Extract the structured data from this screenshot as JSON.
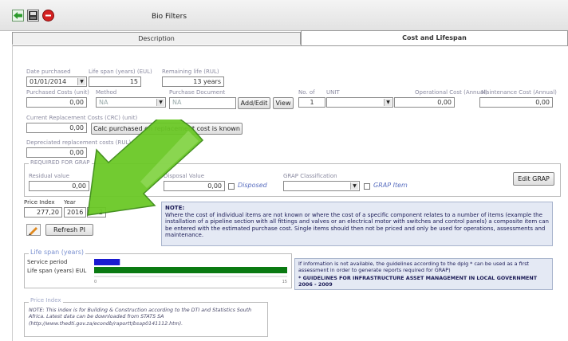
{
  "window": {
    "title": "Bio Filters"
  },
  "toolbar": {
    "back_icon": "green-arrow-icon",
    "save_icon": "disk-icon",
    "delete_icon": "red-minus-icon"
  },
  "tabs": [
    {
      "label": "Description"
    },
    {
      "label": "Cost and Lifespan"
    }
  ],
  "form": {
    "date_purchased": {
      "label": "Date purchased",
      "value": "01/01/2014"
    },
    "life_span": {
      "label": "Life span (years) (EUL)",
      "value": "15"
    },
    "remaining_life": {
      "label": "Remaining life (RUL)",
      "value": "13 years"
    },
    "purchased_costs": {
      "label": "Purchased Costs (unit)",
      "value": "0,00"
    },
    "method": {
      "label": "Method",
      "value": "NA"
    },
    "purchase_document": {
      "label": "Purchase Document",
      "value": "NA"
    },
    "add_edit_label": "Add/Edit",
    "view_label": "View",
    "no_of": {
      "label": "No. of",
      "value": "1"
    },
    "unit": {
      "label": "UNIT",
      "value": ""
    },
    "operational_cost": {
      "label": "Operational Cost (Annual)",
      "value": "0,00"
    },
    "maintenance_cost": {
      "label": "Maintenance Cost (Annual)",
      "value": "0,00"
    },
    "crc": {
      "label": "Current Replacement Costs (CRC) (unit)",
      "value": "0,00"
    },
    "calc_button_label": "Calc purchased on replacement cost is known",
    "depreciated": {
      "label": "Depreciated replacement costs (RUL)",
      "value": "0,00"
    },
    "grap_group_title": "REQUIRED FOR GRAP",
    "residual": {
      "label": "Residual value",
      "value": "0,00"
    },
    "disposal": {
      "label": "Disposal Value",
      "value": "0,00"
    },
    "disposed_label": "Disposed",
    "grap_classification": {
      "label": "GRAP Classification",
      "value": ""
    },
    "grap_item_label": "GRAP Item",
    "edit_grap_label": "Edit GRAP",
    "price_index": {
      "label": "Price Index",
      "value": "277,20"
    },
    "year": {
      "label": "Year",
      "value": "2016",
      "extra": "2"
    },
    "refresh_label": "Refresh PI"
  },
  "note": {
    "title": "NOTE:",
    "body": "Where the cost of individual items are not known or where the cost of a specific component relates to a number of items (example the installation of a pipeline section with all fittings and valves or an electrical motor with switches and control panels) a composite item can be entered with the estimated purchase cost. Single items should then not be priced and only be used for operations, assessments and maintenance."
  },
  "life_span_panel": {
    "title": "Life span (years)",
    "service_label": "Service period",
    "eul_label": "Life span (years) EUL",
    "axis_min": "0",
    "axis_max": "15"
  },
  "chart_data": {
    "type": "bar",
    "categories": [
      "Service period",
      "Life span (years) EUL"
    ],
    "values": [
      2,
      15
    ],
    "xlim": [
      0,
      15
    ],
    "colors": [
      "#1a1ad0",
      "#0a7a12"
    ]
  },
  "guidelines": {
    "text": "If information is not available, the guidelines according to the dplg * can be used as a first assessment in order to generate reports required for GRAP)",
    "title": "* GUIDELINES FOR INFRASTRUCTURE ASSET MANAGEMENT IN LOCAL GOVERNMENT 2006 - 2009"
  },
  "price_note": {
    "title": "Price Index",
    "text": "NOTE: This index is for Building & Construction according to the DTI and Statistics South Africa. Latest data can be downloaded from STATS SA (http://www.thedti.gov.za/econdb/raportt/bsap0141112.htm)."
  }
}
